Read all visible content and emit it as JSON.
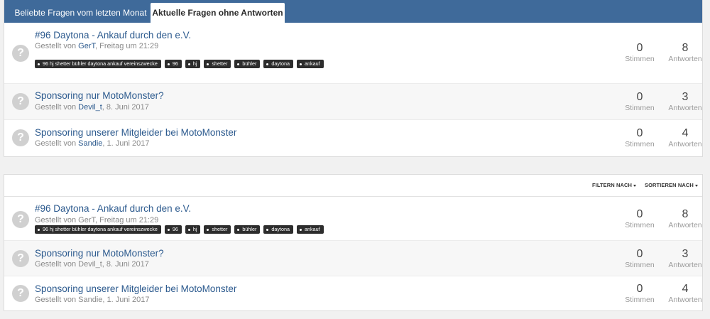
{
  "tabs": [
    {
      "label": "Beliebte Fragen vom letzten Monat",
      "active": false
    },
    {
      "label": "Aktuelle Fragen ohne Antworten",
      "active": true
    }
  ],
  "tags": [
    "96 hj shetter bühler daytona ankauf vereinszwecke",
    "96",
    "hj",
    "shetter",
    "bühler",
    "daytona",
    "ankauf"
  ],
  "questions": [
    {
      "title": "#96 Daytona - Ankauf durch den e.V.",
      "posted_prefix": "Gestellt von",
      "author": "GerT",
      "date": ", Freitag um 21:29",
      "votes": "0",
      "votes_label": "Stimmen",
      "answers": "8",
      "answers_label": "Antworten"
    },
    {
      "title": "Sponsoring nur MotoMonster?",
      "posted_prefix": "Gestellt von",
      "author": "Devil_t",
      "date": ", 8. Juni 2017",
      "votes": "0",
      "votes_label": "Stimmen",
      "answers": "3",
      "answers_label": "Antworten"
    },
    {
      "title": "Sponsoring unserer Mitgleider bei MotoMonster",
      "posted_prefix": "Gestellt von",
      "author": "Sandie",
      "date": ", 1. Juni 2017",
      "votes": "0",
      "votes_label": "Stimmen",
      "answers": "4",
      "answers_label": "Antworten"
    }
  ],
  "filter": {
    "filter_label": "FILTERN NACH",
    "sort_label": "SORTIEREN NACH"
  },
  "avatar_glyph": "?",
  "colors": {
    "tabbar": "#3f6a9a",
    "link": "#2c5a8e",
    "tag_bg": "#2d2d2d"
  }
}
